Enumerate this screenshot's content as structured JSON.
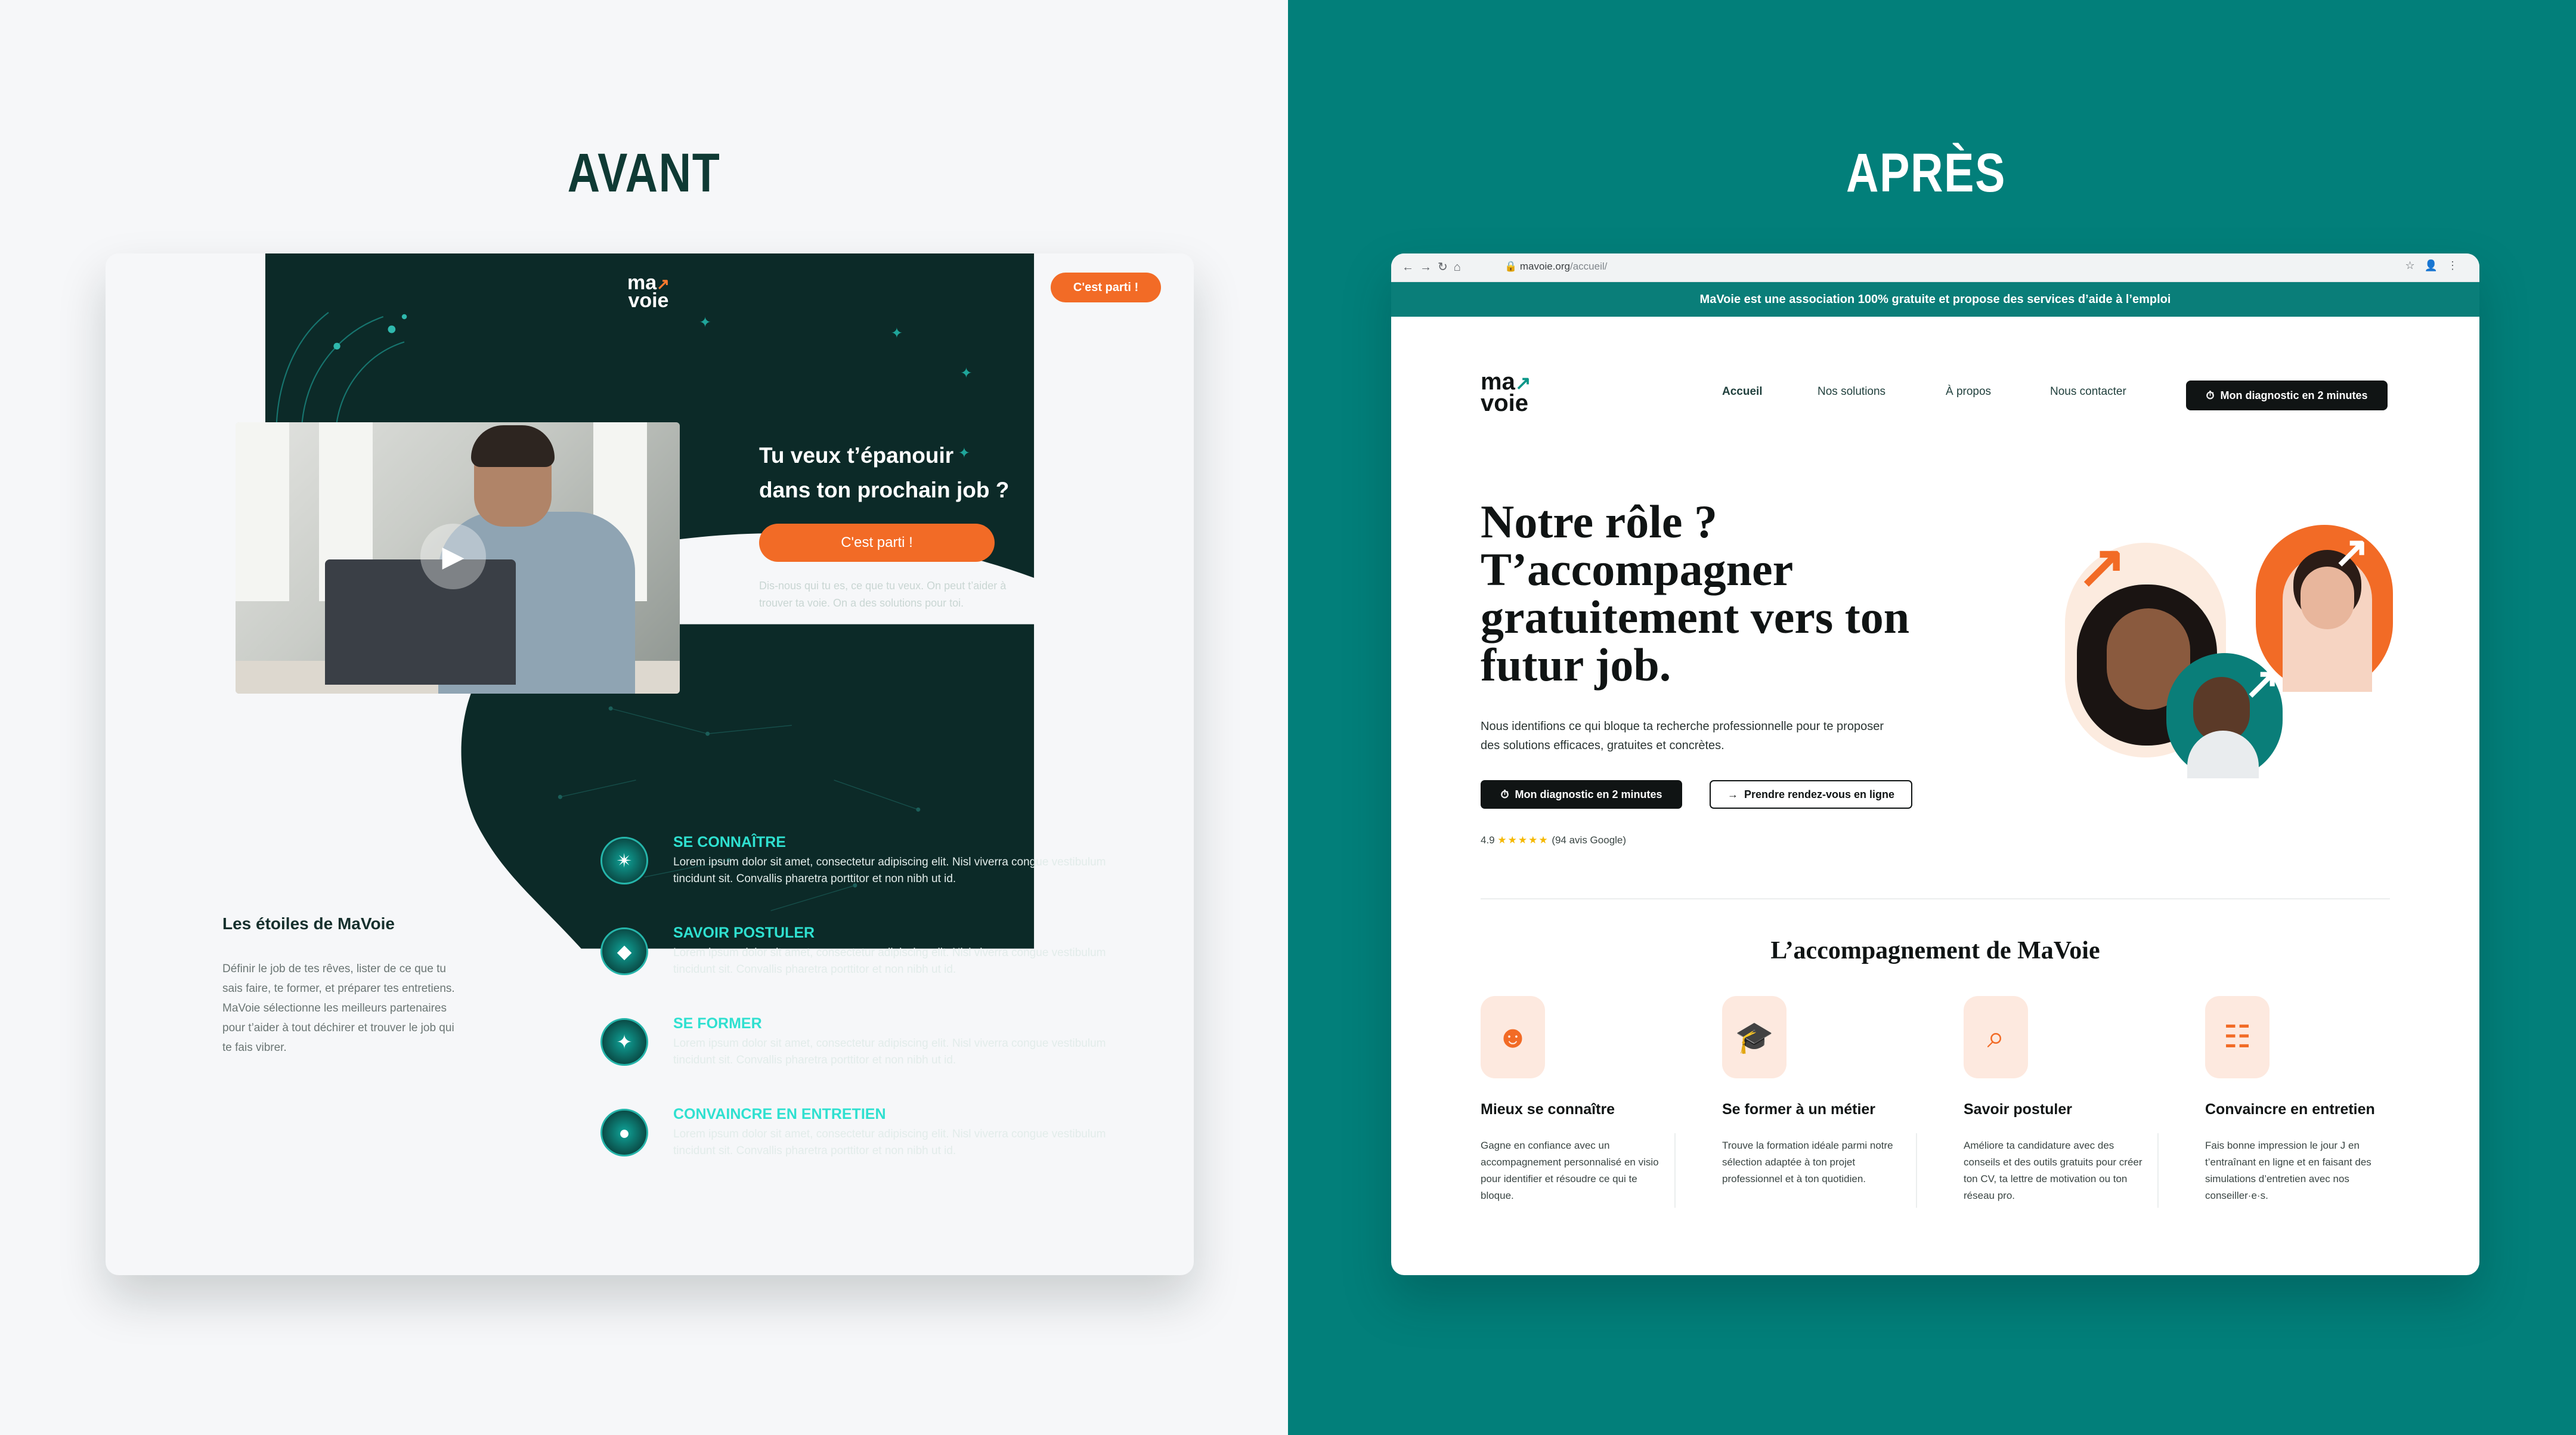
{
  "titles": {
    "left": "AVANT",
    "right": "APRÈS"
  },
  "colors": {
    "teal": "#027f7a",
    "dark": "#0c2a28",
    "orange": "#f26b26",
    "cyan": "#2fe0d0"
  },
  "avant": {
    "logo_top": "ma",
    "logo_bottom": "voie",
    "top_cta": "C'est parti !",
    "headline_1": "Tu veux t’épanouir",
    "headline_2": "dans ton prochain job ?",
    "cta": "C'est parti !",
    "sub_1": "Dis-nous qui tu es, ce que tu veux.  On peut t’aider à",
    "sub_2": "trouver ta voie.  On a des solutions pour toi.",
    "play_icon": "play-icon",
    "stars_title": "Les étoiles de MaVoie",
    "stars_text": "Définir le job de tes rêves, lister de ce que tu sais faire, te former, et préparer tes entretiens. MaVoie sélectionne les meilleurs partenaires pour t’aider à tout déchirer et trouver le job qui te fais vibrer.",
    "items": [
      {
        "title": "SE CONNAÎTRE",
        "line1": "Lorem ipsum dolor sit amet, consectetur adipiscing elit. Nisl viverra congue vestibulum",
        "line2": "tincidunt sit. Convallis pharetra porttitor et non nibh ut id.",
        "icon": "star-orbit-icon"
      },
      {
        "title": "SAVOIR POSTULER",
        "line1": "Lorem ipsum dolor sit amet, consectetur adipiscing elit. Nisl viverra congue vestibulum",
        "line2": "tincidunt sit. Convallis pharetra porttitor et non nibh ut id.",
        "icon": "diamond-icon"
      },
      {
        "title": "SE FORMER",
        "line1": "Lorem ipsum dolor sit amet, consectetur adipiscing elit. Nisl viverra congue vestibulum",
        "line2": "tincidunt sit. Convallis pharetra porttitor et non nibh ut id.",
        "icon": "sparkle-icon"
      },
      {
        "title": "CONVAINCRE EN ENTRETIEN",
        "line1": "Lorem ipsum dolor sit amet, consectetur adipiscing elit. Nisl viverra congue vestibulum",
        "line2": "tincidunt sit. Convallis pharetra porttitor et non nibh ut id.",
        "icon": "sun-icon"
      }
    ]
  },
  "apres": {
    "browser": {
      "url_host": "mavoie.org",
      "url_path": "/accueil/"
    },
    "banner": "MaVoie est une association 100% gratuite et propose des services d’aide à l’emploi",
    "logo_top": "ma",
    "logo_bottom": "voie",
    "nav": [
      "Accueil",
      "Nos solutions",
      "À propos",
      "Nous contacter"
    ],
    "top_cta": "Mon diagnostic en 2 minutes",
    "h1_lines": [
      "Notre rôle ?",
      "T’accompagner",
      "gratuitement vers ton",
      "futur job."
    ],
    "lead_1": "Nous identifions ce qui bloque ta recherche professionnelle pour te proposer",
    "lead_2": "des solutions efficaces, gratuites et concrètes.",
    "btn_primary": "Mon diagnostic en 2 minutes",
    "btn_secondary": "Prendre rendez-vous en ligne",
    "rating_value": "4.9",
    "rating_stars": "★★★★★",
    "rating_count": "(94 avis Google)",
    "section_title": "L’accompagnement de MaVoie",
    "columns": [
      {
        "title": "Mieux se connaître",
        "text": "Gagne en confiance avec un accompagnement personnalisé en visio pour identifier et résoudre ce qui te bloque.",
        "icon": "person-icon"
      },
      {
        "title": "Se former à un métier",
        "text": "Trouve la formation idéale parmi notre sélection adaptée à ton projet professionnel et à ton quotidien.",
        "icon": "graduation-cap-icon"
      },
      {
        "title": "Savoir postuler",
        "text": "Améliore ta candidature avec des conseils et des outils gratuits pour créer ton CV, ta lettre de motivation ou ton réseau pro.",
        "icon": "search-person-icon"
      },
      {
        "title": "Convaincre en entretien",
        "text": "Fais bonne impression le jour J en t’entraînant en ligne et en faisant des simulations d’entretien avec nos conseiller·e·s.",
        "icon": "interview-icon"
      }
    ]
  }
}
